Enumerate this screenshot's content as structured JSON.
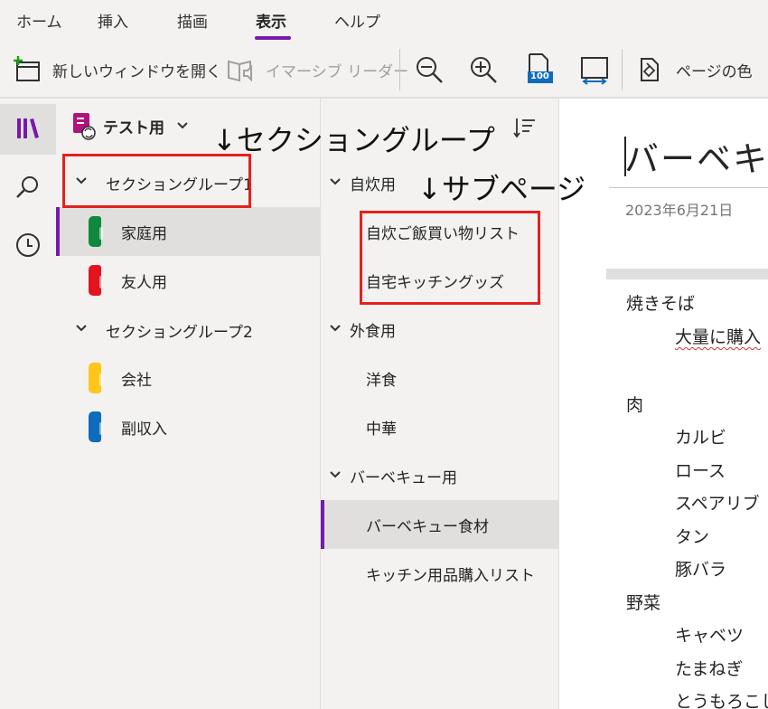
{
  "ribbon": {
    "tabs": [
      "ホーム",
      "挿入",
      "描画",
      "表示",
      "ヘルプ"
    ],
    "active_tab": "表示"
  },
  "toolbar": {
    "new_window": "新しいウィンドウを開く",
    "immersive_reader": "イマーシブ リーダー",
    "zoom_badge": "100",
    "page_color": "ページの色"
  },
  "notebook": {
    "name": "テスト用"
  },
  "sections": {
    "groups": [
      {
        "label": "セクショングループ1",
        "items": [
          {
            "label": "家庭用",
            "color": "#0f8a3c",
            "active": true
          },
          {
            "label": "友人用",
            "color": "#e3141f",
            "active": false
          }
        ]
      },
      {
        "label": "セクショングループ2",
        "items": [
          {
            "label": "会社",
            "color": "#ffc61a",
            "active": false
          },
          {
            "label": "副収入",
            "color": "#0f6cbd",
            "active": false
          }
        ]
      }
    ]
  },
  "pages": {
    "items": [
      {
        "label": "自炊用",
        "type": "parent"
      },
      {
        "label": "自炊ご飯買い物リスト",
        "type": "subpage"
      },
      {
        "label": "自宅キッチングッズ",
        "type": "subpage"
      },
      {
        "label": "外食用",
        "type": "parent"
      },
      {
        "label": "洋食",
        "type": "subpage"
      },
      {
        "label": "中華",
        "type": "subpage"
      },
      {
        "label": "バーベキュー用",
        "type": "parent"
      },
      {
        "label": "バーベキュー食材",
        "type": "subpage",
        "active": true
      },
      {
        "label": "キッチン用品購入リスト",
        "type": "subpage"
      }
    ]
  },
  "canvas": {
    "title": "バーベキュー食材",
    "date": "2023年6月21日",
    "lines": [
      "焼きそば",
      "大量に購入",
      "肉",
      "カルビ",
      "ロース",
      "スペアリブ",
      "タン",
      "豚バラ",
      "野菜",
      "キャベツ",
      "たまねぎ",
      "とうもろこし"
    ]
  },
  "annotations": {
    "section_group_label": "↓セクショングループ",
    "subpage_label": "↓サブページ"
  },
  "colors": {
    "accent": "#7719aa",
    "annotation_red": "#e5211e"
  }
}
